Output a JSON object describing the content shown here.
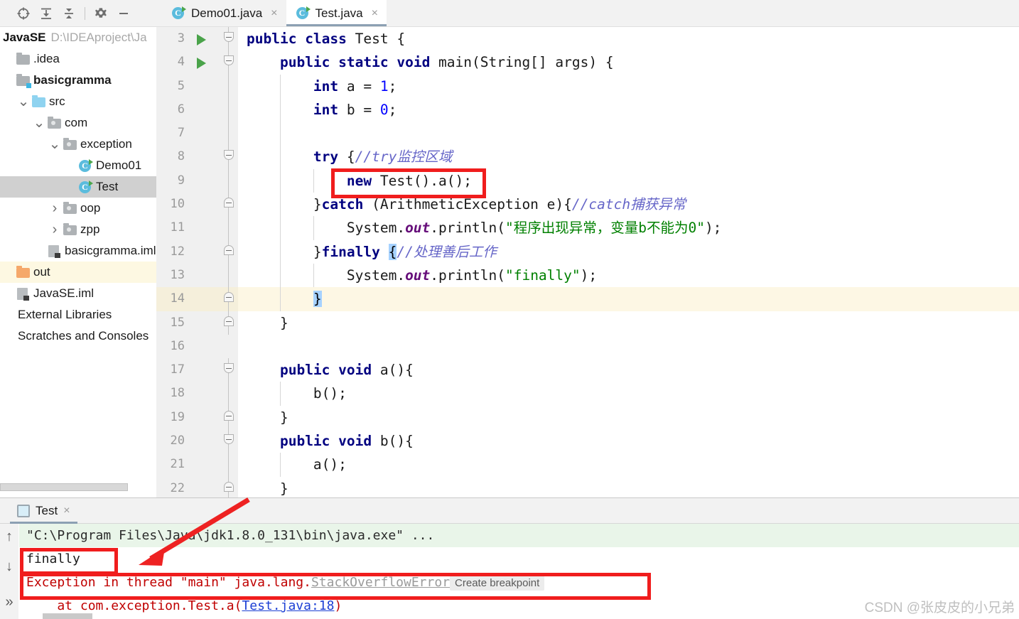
{
  "toolbar": {
    "buttons": [
      {
        "name": "locate-icon",
        "glyph": "crosshair"
      },
      {
        "name": "expand-all-icon",
        "glyph": "expand"
      },
      {
        "name": "collapse-all-icon",
        "glyph": "collapse"
      },
      {
        "name": "settings-gear-icon",
        "glyph": "gear"
      },
      {
        "name": "hide-panel-icon",
        "glyph": "minus"
      }
    ]
  },
  "editor_tabs": [
    {
      "label": "Demo01.java",
      "icon": "java-class-icon",
      "active": false,
      "close": "×"
    },
    {
      "label": "Test.java",
      "icon": "java-class-icon",
      "active": true,
      "close": "×"
    }
  ],
  "project": {
    "name": "JavaSE",
    "path": "D:\\IDEAproject\\Ja",
    "tree": [
      {
        "label": ".idea",
        "indent": 0,
        "twisty": "",
        "icon": "folder-grey",
        "bold": false,
        "state": "normal"
      },
      {
        "label": "basicgramma",
        "indent": 0,
        "twisty": "",
        "icon": "folder-module",
        "bold": true,
        "state": "normal"
      },
      {
        "label": "src",
        "indent": 1,
        "twisty": "v",
        "icon": "folder-blue",
        "bold": false,
        "state": "normal"
      },
      {
        "label": "com",
        "indent": 2,
        "twisty": "v",
        "icon": "folder-package",
        "bold": false,
        "state": "normal"
      },
      {
        "label": "exception",
        "indent": 3,
        "twisty": "v",
        "icon": "folder-package",
        "bold": false,
        "state": "normal"
      },
      {
        "label": "Demo01",
        "indent": 4,
        "twisty": "",
        "icon": "java-class-icon",
        "bold": false,
        "state": "normal"
      },
      {
        "label": "Test",
        "indent": 4,
        "twisty": "",
        "icon": "java-class-icon",
        "bold": false,
        "state": "selected"
      },
      {
        "label": "oop",
        "indent": 3,
        "twisty": ">",
        "icon": "folder-package",
        "bold": false,
        "state": "normal"
      },
      {
        "label": "zpp",
        "indent": 3,
        "twisty": ">",
        "icon": "folder-package",
        "bold": false,
        "state": "normal"
      },
      {
        "label": "basicgramma.iml",
        "indent": 2,
        "twisty": "",
        "icon": "iml-file",
        "bold": false,
        "state": "normal"
      },
      {
        "label": "out",
        "indent": 0,
        "twisty": "",
        "icon": "folder-orange",
        "bold": false,
        "state": "tinted"
      },
      {
        "label": "JavaSE.iml",
        "indent": 0,
        "twisty": "",
        "icon": "iml-file",
        "bold": false,
        "state": "normal"
      },
      {
        "label": "External Libraries",
        "indent": 0,
        "twisty": "",
        "icon": "none",
        "bold": false,
        "state": "normal"
      },
      {
        "label": "Scratches and Consoles",
        "indent": 0,
        "twisty": "",
        "icon": "none",
        "bold": false,
        "state": "normal"
      }
    ]
  },
  "code": {
    "lines": [
      {
        "num": "3",
        "run": true,
        "fold": "down",
        "caret": false,
        "indent_guides": 0,
        "tokens": [
          {
            "t": "public ",
            "c": "kw"
          },
          {
            "t": "class ",
            "c": "kw"
          },
          {
            "t": "Test {",
            "c": "plain"
          }
        ]
      },
      {
        "num": "4",
        "run": true,
        "fold": "down",
        "caret": false,
        "indent_guides": 0,
        "tokens": [
          {
            "t": "    ",
            "c": "plain"
          },
          {
            "t": "public ",
            "c": "kw"
          },
          {
            "t": "static ",
            "c": "kw"
          },
          {
            "t": "void ",
            "c": "kw"
          },
          {
            "t": "main(String[] args) {",
            "c": "plain"
          }
        ]
      },
      {
        "num": "5",
        "run": false,
        "fold": "line",
        "caret": false,
        "indent_guides": 1,
        "tokens": [
          {
            "t": "        ",
            "c": "plain"
          },
          {
            "t": "int ",
            "c": "kw"
          },
          {
            "t": "a = ",
            "c": "plain"
          },
          {
            "t": "1",
            "c": "num"
          },
          {
            "t": ";",
            "c": "plain"
          }
        ]
      },
      {
        "num": "6",
        "run": false,
        "fold": "line",
        "caret": false,
        "indent_guides": 1,
        "tokens": [
          {
            "t": "        ",
            "c": "plain"
          },
          {
            "t": "int ",
            "c": "kw"
          },
          {
            "t": "b = ",
            "c": "plain"
          },
          {
            "t": "0",
            "c": "num"
          },
          {
            "t": ";",
            "c": "plain"
          }
        ]
      },
      {
        "num": "7",
        "run": false,
        "fold": "line",
        "caret": false,
        "indent_guides": 1,
        "tokens": [
          {
            "t": "",
            "c": "plain"
          }
        ]
      },
      {
        "num": "8",
        "run": false,
        "fold": "down",
        "caret": false,
        "indent_guides": 1,
        "tokens": [
          {
            "t": "        ",
            "c": "plain"
          },
          {
            "t": "try ",
            "c": "kw"
          },
          {
            "t": "{",
            "c": "plain"
          },
          {
            "t": "//try监控区域",
            "c": "cmt"
          }
        ]
      },
      {
        "num": "9",
        "run": false,
        "fold": "line",
        "caret": false,
        "indent_guides": 2,
        "tokens": [
          {
            "t": "            ",
            "c": "plain"
          },
          {
            "t": "new ",
            "c": "kw"
          },
          {
            "t": "Test().a();",
            "c": "plain"
          }
        ]
      },
      {
        "num": "10",
        "run": false,
        "fold": "up",
        "caret": false,
        "indent_guides": 1,
        "tokens": [
          {
            "t": "        }",
            "c": "plain"
          },
          {
            "t": "catch ",
            "c": "kw"
          },
          {
            "t": "(ArithmeticException e){",
            "c": "plain"
          },
          {
            "t": "//catch捕获异常",
            "c": "cmt"
          }
        ]
      },
      {
        "num": "11",
        "run": false,
        "fold": "line",
        "caret": false,
        "indent_guides": 2,
        "tokens": [
          {
            "t": "            System.",
            "c": "plain"
          },
          {
            "t": "out",
            "c": "fld"
          },
          {
            "t": ".println(",
            "c": "plain"
          },
          {
            "t": "\"程序出现异常，变量b不能为0\"",
            "c": "str"
          },
          {
            "t": ");",
            "c": "plain"
          }
        ]
      },
      {
        "num": "12",
        "run": false,
        "fold": "up",
        "caret": false,
        "indent_guides": 1,
        "tokens": [
          {
            "t": "        }",
            "c": "plain"
          },
          {
            "t": "finally ",
            "c": "kw"
          },
          {
            "t": "{",
            "c": "sel"
          },
          {
            "t": "//处理善后工作",
            "c": "cmt"
          }
        ]
      },
      {
        "num": "13",
        "run": false,
        "fold": "line",
        "caret": false,
        "indent_guides": 2,
        "tokens": [
          {
            "t": "            System.",
            "c": "plain"
          },
          {
            "t": "out",
            "c": "fld"
          },
          {
            "t": ".println(",
            "c": "plain"
          },
          {
            "t": "\"finally\"",
            "c": "str"
          },
          {
            "t": ");",
            "c": "plain"
          }
        ]
      },
      {
        "num": "14",
        "run": false,
        "fold": "up",
        "caret": true,
        "indent_guides": 1,
        "tokens": [
          {
            "t": "        ",
            "c": "plain"
          },
          {
            "t": "}",
            "c": "sel"
          }
        ]
      },
      {
        "num": "15",
        "run": false,
        "fold": "up",
        "caret": false,
        "indent_guides": 0,
        "tokens": [
          {
            "t": "    }",
            "c": "plain"
          }
        ]
      },
      {
        "num": "16",
        "run": false,
        "fold": "none",
        "caret": false,
        "indent_guides": 0,
        "tokens": [
          {
            "t": "",
            "c": "plain"
          }
        ]
      },
      {
        "num": "17",
        "run": false,
        "fold": "down",
        "caret": false,
        "indent_guides": 0,
        "tokens": [
          {
            "t": "    ",
            "c": "plain"
          },
          {
            "t": "public ",
            "c": "kw"
          },
          {
            "t": "void ",
            "c": "kw"
          },
          {
            "t": "a(){",
            "c": "plain"
          }
        ]
      },
      {
        "num": "18",
        "run": false,
        "fold": "line",
        "caret": false,
        "indent_guides": 1,
        "tokens": [
          {
            "t": "        b();",
            "c": "plain"
          }
        ]
      },
      {
        "num": "19",
        "run": false,
        "fold": "up",
        "caret": false,
        "indent_guides": 0,
        "tokens": [
          {
            "t": "    }",
            "c": "plain"
          }
        ]
      },
      {
        "num": "20",
        "run": false,
        "fold": "down",
        "caret": false,
        "indent_guides": 0,
        "tokens": [
          {
            "t": "    ",
            "c": "plain"
          },
          {
            "t": "public ",
            "c": "kw"
          },
          {
            "t": "void ",
            "c": "kw"
          },
          {
            "t": "b(){",
            "c": "plain"
          }
        ]
      },
      {
        "num": "21",
        "run": false,
        "fold": "line",
        "caret": false,
        "indent_guides": 1,
        "tokens": [
          {
            "t": "        a();",
            "c": "plain"
          }
        ]
      },
      {
        "num": "22",
        "run": false,
        "fold": "up",
        "caret": false,
        "indent_guides": 0,
        "tokens": [
          {
            "t": "    }",
            "c": "plain"
          }
        ]
      }
    ]
  },
  "run_panel": {
    "tab_label": "Test",
    "tab_close": "×",
    "side_buttons": [
      {
        "name": "scroll-up-button",
        "glyph": "↑"
      },
      {
        "name": "scroll-down-button",
        "glyph": "↓"
      },
      {
        "name": "expand-more-button",
        "glyph": "»"
      }
    ],
    "console": [
      {
        "kind": "cmd",
        "text": "\"C:\\Program Files\\Java\\jdk1.8.0_131\\bin\\java.exe\" ..."
      },
      {
        "kind": "out",
        "text": "finally"
      },
      {
        "kind": "err",
        "prefix": "Exception in thread \"main\" java.lang.",
        "link": "StackOverflowError",
        "crumb": "Create breakpoint"
      },
      {
        "kind": "err",
        "prefix": "    at com.exception.Test.a(",
        "errlink": "Test.java:18",
        "suffix": ")"
      }
    ]
  },
  "watermark": "CSDN @张皮皮的小兄弟",
  "colors": {
    "accent": "#8ca0b3",
    "annotation_red": "#f01d1d",
    "caret_line": "#fdf7e4",
    "selection": "#a6d2ff",
    "console_cmd_bg": "#e9f5e9",
    "error_text": "#c00000"
  }
}
